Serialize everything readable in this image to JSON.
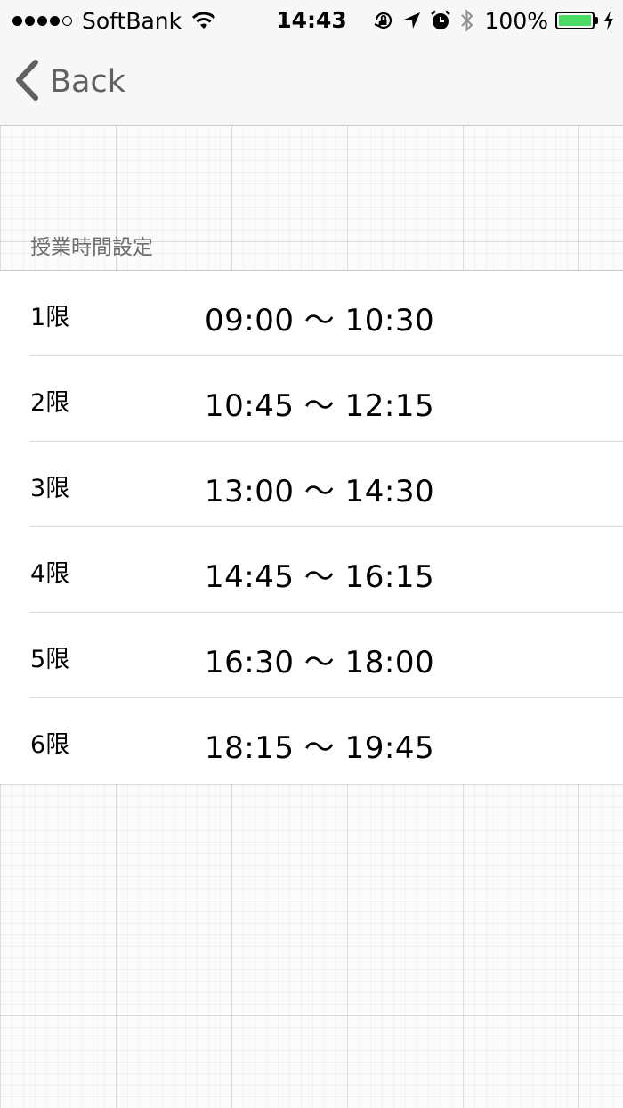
{
  "status_bar": {
    "carrier": "SoftBank",
    "time": "14:43",
    "battery_percent": "100%",
    "signal_bars_filled": 4,
    "signal_bars_total": 5,
    "battery_level": 1.0,
    "battery_color": "#4cd964",
    "icons": [
      "wifi-icon",
      "orientation-lock-icon",
      "location-arrow-icon",
      "alarm-icon",
      "bluetooth-icon",
      "charging-bolt-icon"
    ]
  },
  "nav": {
    "back_label": "Back",
    "back_icon": "chevron-left-icon"
  },
  "section": {
    "header": "授業時間設定"
  },
  "periods": [
    {
      "label": "1限",
      "time": "09:00 〜 10:30"
    },
    {
      "label": "2限",
      "time": "10:45 〜 12:15"
    },
    {
      "label": "3限",
      "time": "13:00 〜 14:30"
    },
    {
      "label": "4限",
      "time": "14:45 〜 16:15"
    },
    {
      "label": "5限",
      "time": "16:30 〜 18:00"
    },
    {
      "label": "6限",
      "time": "18:15 〜 19:45"
    }
  ]
}
